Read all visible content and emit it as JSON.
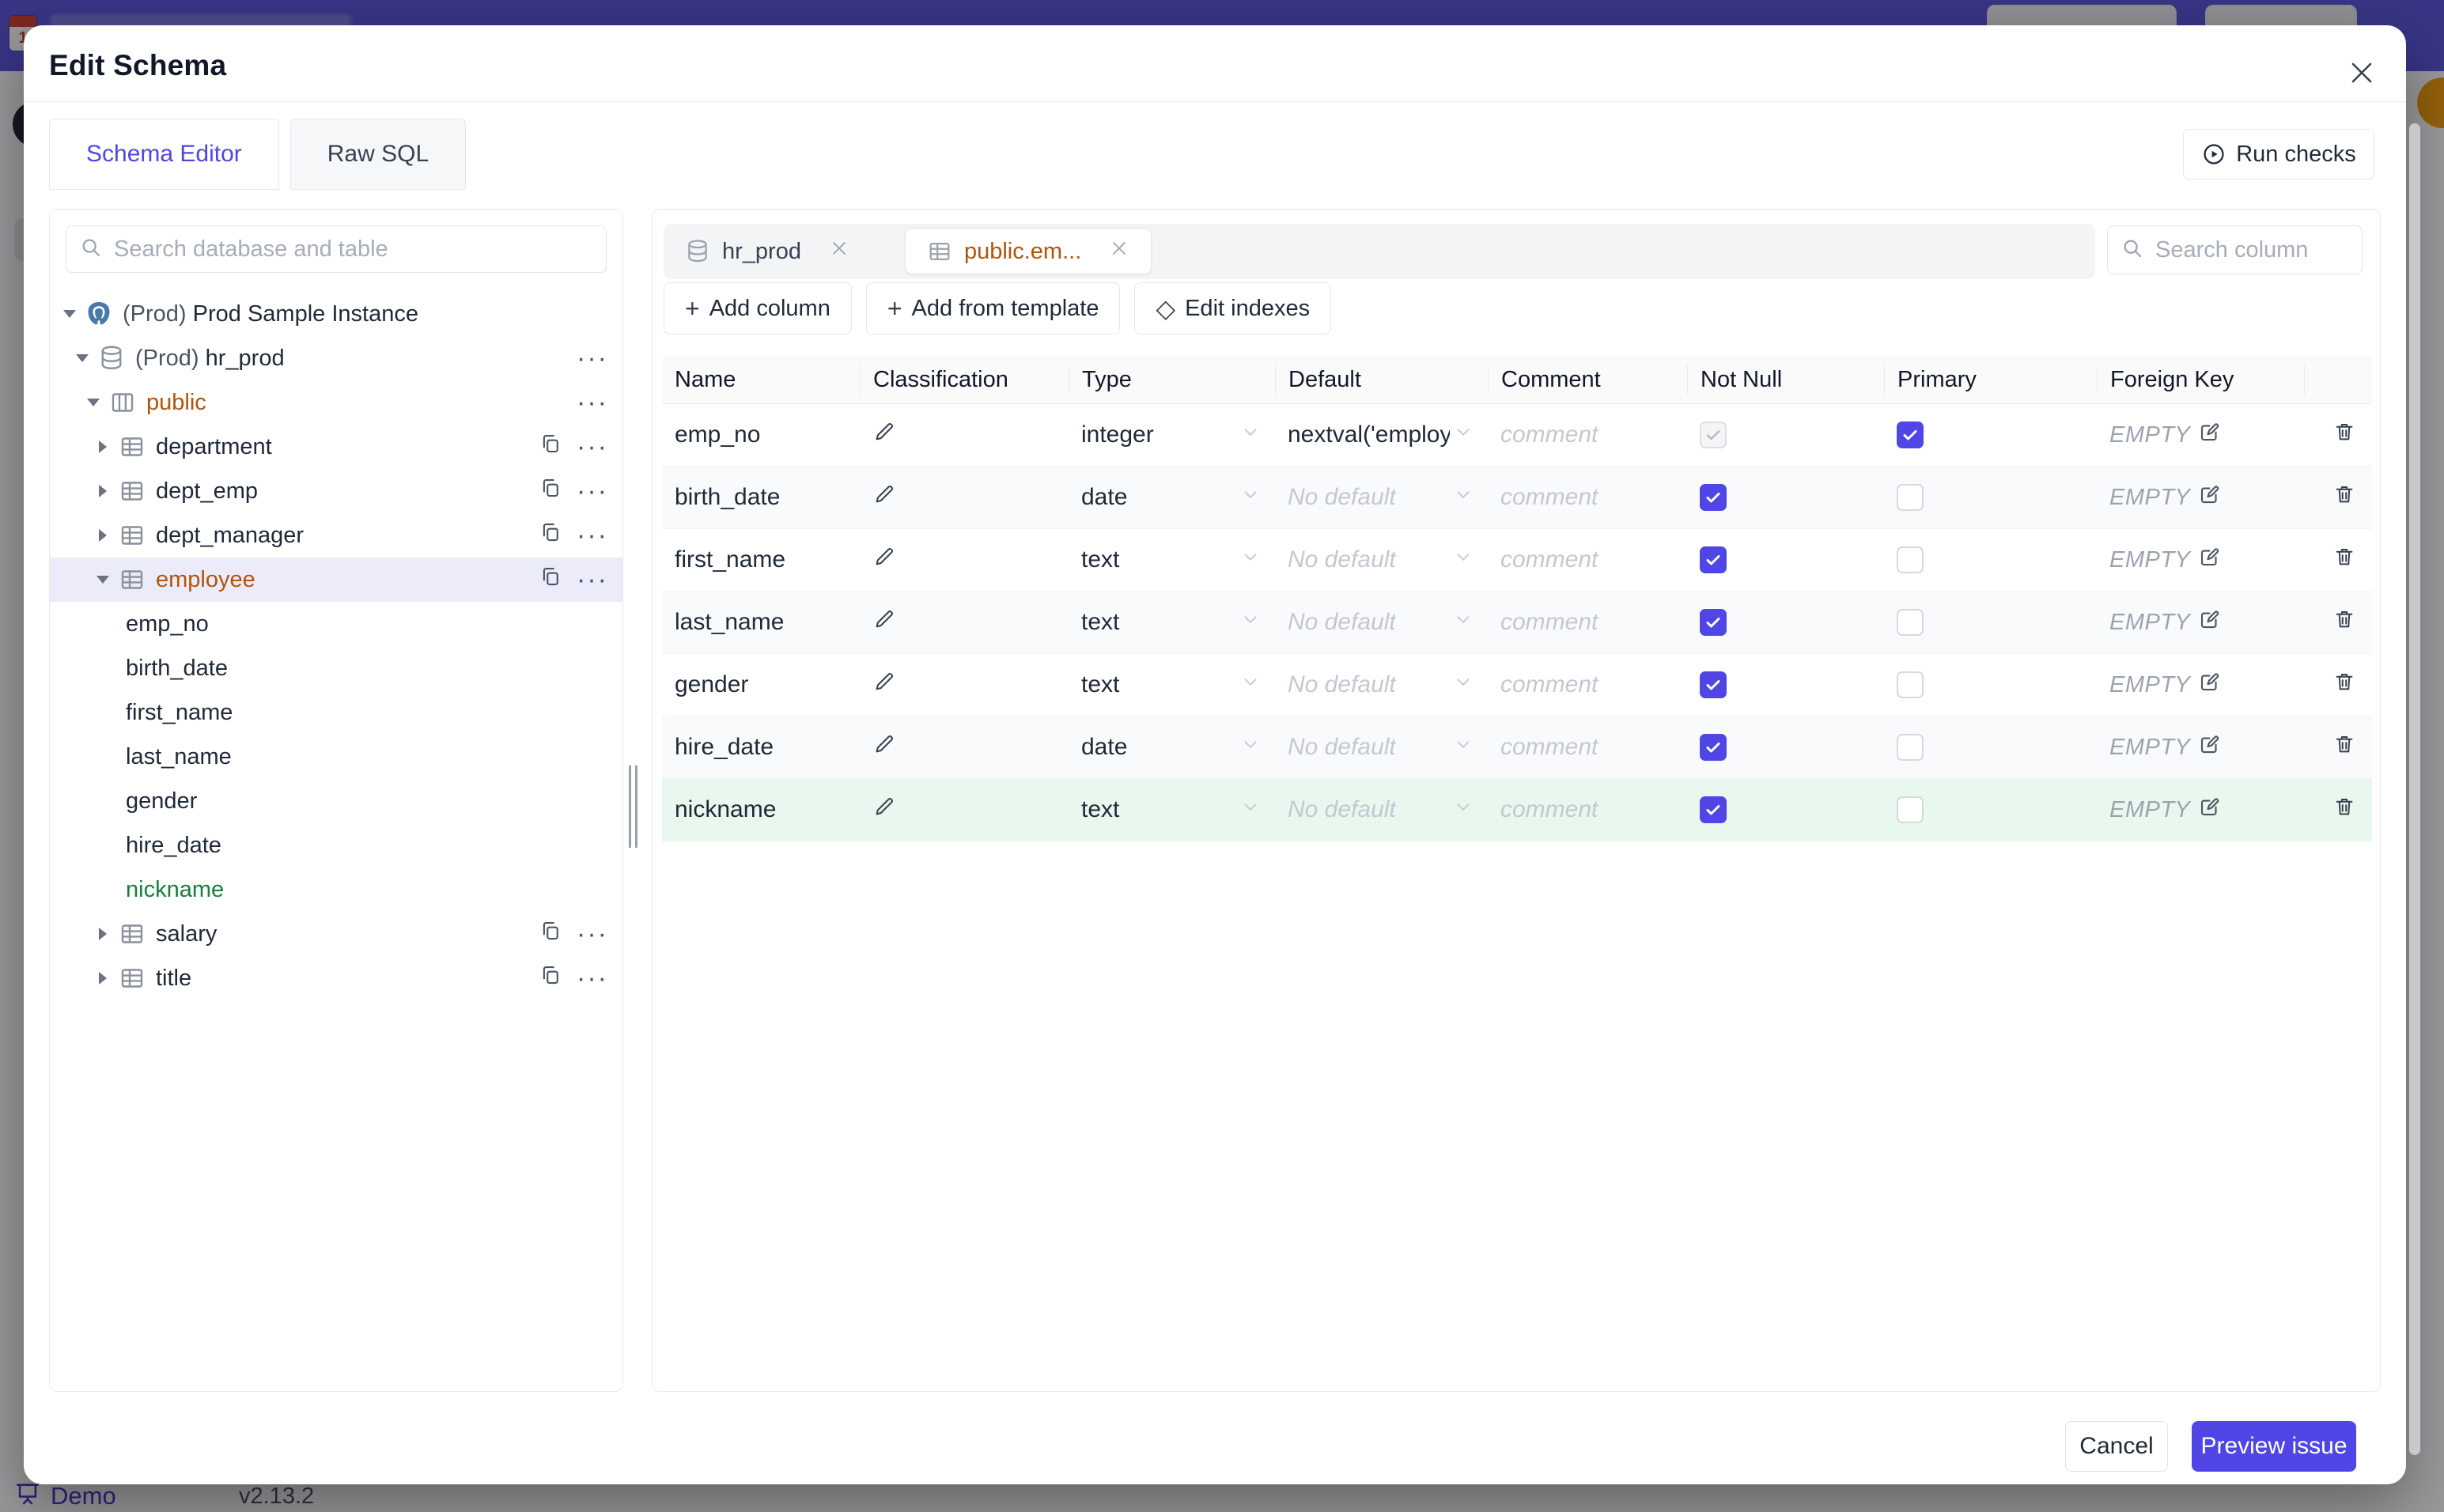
{
  "colors": {
    "accent": "#4f46e5",
    "amber_schema": "#b45309",
    "green_added_text": "#15803d",
    "green_added_row_bg": "#e9f8ef",
    "banner_indigo": "#5a55dd",
    "avatar_orange": "#f59e0b",
    "selected_tree_bg": "#ecebfa"
  },
  "backdrop": {
    "demo_label": "Demo",
    "version": "v2.13.2"
  },
  "modal": {
    "title": "Edit Schema",
    "tabs": [
      {
        "label": "Schema Editor",
        "active": true
      },
      {
        "label": "Raw SQL",
        "active": false
      }
    ],
    "run_checks_label": "Run checks",
    "sidebar": {
      "search_placeholder": "Search database and table",
      "tree": [
        {
          "level": 0,
          "caret": "down",
          "icon": "postgres",
          "prefix": "(Prod) ",
          "label": "Prod Sample Instance",
          "actions": []
        },
        {
          "level": 1,
          "caret": "down",
          "icon": "database",
          "prefix": "(Prod) ",
          "label": "hr_prod",
          "actions": [
            "more"
          ]
        },
        {
          "level": 2,
          "caret": "down",
          "icon": "schema",
          "label": "public",
          "style": "amber",
          "actions": [
            "more"
          ]
        },
        {
          "level": 3,
          "caret": "right",
          "icon": "table",
          "label": "department",
          "actions": [
            "copy",
            "more"
          ]
        },
        {
          "level": 3,
          "caret": "right",
          "icon": "table",
          "label": "dept_emp",
          "actions": [
            "copy",
            "more"
          ]
        },
        {
          "level": 3,
          "caret": "right",
          "icon": "table",
          "label": "dept_manager",
          "actions": [
            "copy",
            "more"
          ]
        },
        {
          "level": 3,
          "caret": "down",
          "icon": "table",
          "label": "employee",
          "style": "amber",
          "selected": true,
          "actions": [
            "copy",
            "more"
          ]
        },
        {
          "level": 4,
          "label": "emp_no"
        },
        {
          "level": 4,
          "label": "birth_date"
        },
        {
          "level": 4,
          "label": "first_name"
        },
        {
          "level": 4,
          "label": "last_name"
        },
        {
          "level": 4,
          "label": "gender"
        },
        {
          "level": 4,
          "label": "hire_date"
        },
        {
          "level": 4,
          "label": "nickname",
          "style": "green"
        },
        {
          "level": 3,
          "caret": "right",
          "icon": "table",
          "label": "salary",
          "actions": [
            "copy",
            "more"
          ]
        },
        {
          "level": 3,
          "caret": "right",
          "icon": "table",
          "label": "title",
          "actions": [
            "copy",
            "more"
          ]
        }
      ]
    },
    "editor": {
      "chips": [
        {
          "label": "hr_prod",
          "icon": "database",
          "active": false
        },
        {
          "label": "public.em...",
          "icon": "table",
          "active": true
        }
      ],
      "column_search_placeholder": "Search column",
      "toolbar": [
        {
          "label": "Add column",
          "icon": "plus"
        },
        {
          "label": "Add from template",
          "icon": "plus"
        },
        {
          "label": "Edit indexes",
          "icon": "diamond"
        }
      ],
      "table": {
        "headers": [
          "Name",
          "Classification",
          "Type",
          "Default",
          "Comment",
          "Not Null",
          "Primary",
          "Foreign Key",
          ""
        ],
        "comment_placeholder": "comment",
        "fk_empty_label": "EMPTY",
        "rows": [
          {
            "name": "emp_no",
            "type": "integer",
            "default": "nextval('employ",
            "default_is_placeholder": false,
            "not_null": true,
            "not_null_disabled": true,
            "primary": true,
            "added": false
          },
          {
            "name": "birth_date",
            "type": "date",
            "default": "No default",
            "default_is_placeholder": true,
            "not_null": true,
            "not_null_disabled": false,
            "primary": false,
            "added": false
          },
          {
            "name": "first_name",
            "type": "text",
            "default": "No default",
            "default_is_placeholder": true,
            "not_null": true,
            "not_null_disabled": false,
            "primary": false,
            "added": false
          },
          {
            "name": "last_name",
            "type": "text",
            "default": "No default",
            "default_is_placeholder": true,
            "not_null": true,
            "not_null_disabled": false,
            "primary": false,
            "added": false
          },
          {
            "name": "gender",
            "type": "text",
            "default": "No default",
            "default_is_placeholder": true,
            "not_null": true,
            "not_null_disabled": false,
            "primary": false,
            "added": false
          },
          {
            "name": "hire_date",
            "type": "date",
            "default": "No default",
            "default_is_placeholder": true,
            "not_null": true,
            "not_null_disabled": false,
            "primary": false,
            "added": false
          },
          {
            "name": "nickname",
            "type": "text",
            "default": "No default",
            "default_is_placeholder": true,
            "not_null": true,
            "not_null_disabled": false,
            "primary": false,
            "added": true
          }
        ]
      }
    },
    "footer": {
      "cancel_label": "Cancel",
      "primary_label": "Preview issue"
    }
  }
}
